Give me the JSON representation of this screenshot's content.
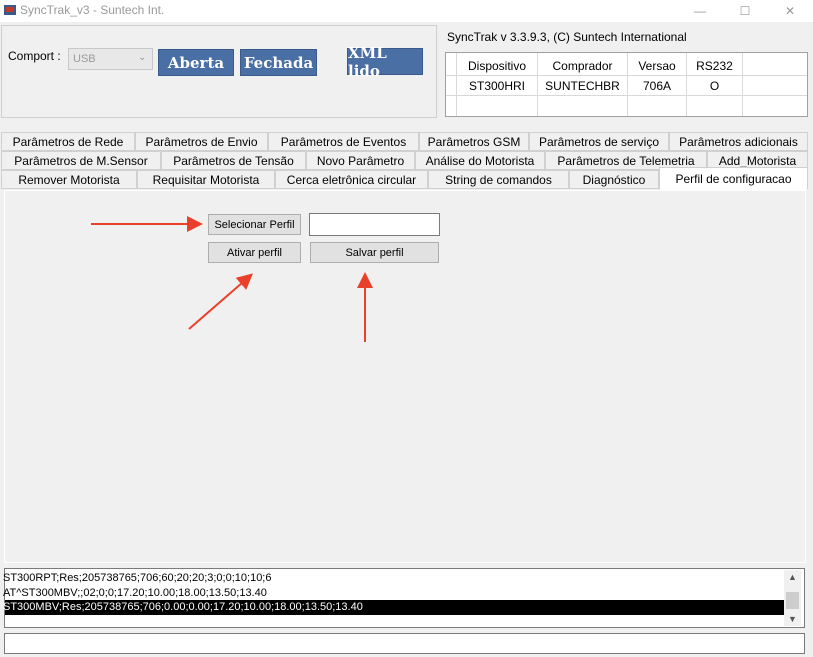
{
  "window": {
    "title": "SyncTrak_v3 - Suntech Int."
  },
  "comport": {
    "label": "Comport :",
    "selected": "USB",
    "buttons": {
      "open": "Aberta",
      "close": "Fechada",
      "xml": "XML lido"
    }
  },
  "info": {
    "title": "SyncTrak v 3.3.9.3, (C) Suntech International",
    "headers": [
      "Dispositivo",
      "Comprador",
      "Versao",
      "RS232"
    ],
    "row": [
      "ST300HRI",
      "SUNTECHBR",
      "706A",
      "O"
    ]
  },
  "tabs": {
    "row1": [
      "Parâmetros de Rede",
      "Parâmetros de Envio",
      "Parâmetros de Eventos",
      "Parâmetros GSM",
      "Parâmetros de serviço",
      "Parâmetros adicionais"
    ],
    "row2": [
      "Parâmetros  de M.Sensor",
      "Parâmetros de Tensão",
      "Novo Parâmetro",
      "Análise do Motorista",
      "Parâmetros de Telemetria",
      "Add_Motorista"
    ],
    "row3": [
      "Remover Motorista",
      "Requisitar Motorista",
      "Cerca eletrônica circular",
      "String de comandos",
      "Diagnóstico",
      "Perfil de configuracao"
    ],
    "active": "Perfil de configuracao"
  },
  "profile": {
    "select_label": "Selecionar Perfil",
    "input_value": "",
    "activate_label": "Ativar perfil",
    "save_label": "Salvar perfil"
  },
  "log": {
    "lines": [
      "ST300RPT;Res;205738765;706;60;20;20;3;0;0;10;10;6",
      "AT^ST300MBV;;02;0;0;17.20;10.00;18.00;13.50;13.40",
      "ST300MBV;Res;205738765;706;0.00;0.00;17.20;10.00;18.00;13.50;13.40"
    ],
    "selected_index": 2
  },
  "colors": {
    "accent_button": "#4a6fa5",
    "arrow": "#e8402a",
    "selection": "#000000"
  }
}
